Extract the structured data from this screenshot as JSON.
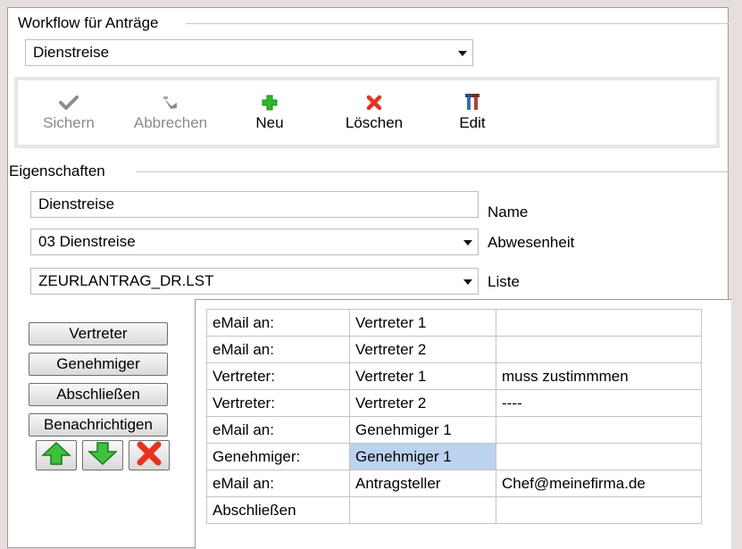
{
  "workflow": {
    "legend": "Workflow für Anträge",
    "selected": "Dienstreise"
  },
  "toolbar": {
    "save_label": "Sichern",
    "cancel_label": "Abbrechen",
    "new_label": "Neu",
    "delete_label": "Löschen",
    "edit_label": "Edit"
  },
  "properties": {
    "legend": "Eigenschaften",
    "name_value": "Dienstreise",
    "name_label": "Name",
    "absence_value": "03 Dienstreise",
    "absence_label": "Abwesenheit",
    "list_value": "ZEURLANTRAG_DR.LST",
    "list_label": "Liste"
  },
  "side_buttons": {
    "vertreter": "Vertreter",
    "genehmiger": "Genehmiger",
    "abschliessen": "Abschließen",
    "benachrichtigen": "Benachrichtigen"
  },
  "colors": {
    "selected_cell": "#bcd3ef",
    "arrow_green": "#3cc23c",
    "delete_red": "#e8321e"
  },
  "steps": [
    {
      "action": "eMail an:",
      "target": "Vertreter 1",
      "note": ""
    },
    {
      "action": "eMail an:",
      "target": "Vertreter 2",
      "note": ""
    },
    {
      "action": "Vertreter:",
      "target": "Vertreter 1",
      "note": "muss zustimmmen"
    },
    {
      "action": "Vertreter:",
      "target": "Vertreter 2",
      "note": "----"
    },
    {
      "action": "eMail an:",
      "target": "Genehmiger 1",
      "note": ""
    },
    {
      "action": "Genehmiger:",
      "target": "Genehmiger 1",
      "note": ""
    },
    {
      "action": "eMail an:",
      "target": "Antragsteller",
      "note": "Chef@meinefirma.de"
    },
    {
      "action": "Abschließen",
      "target": "",
      "note": ""
    }
  ]
}
